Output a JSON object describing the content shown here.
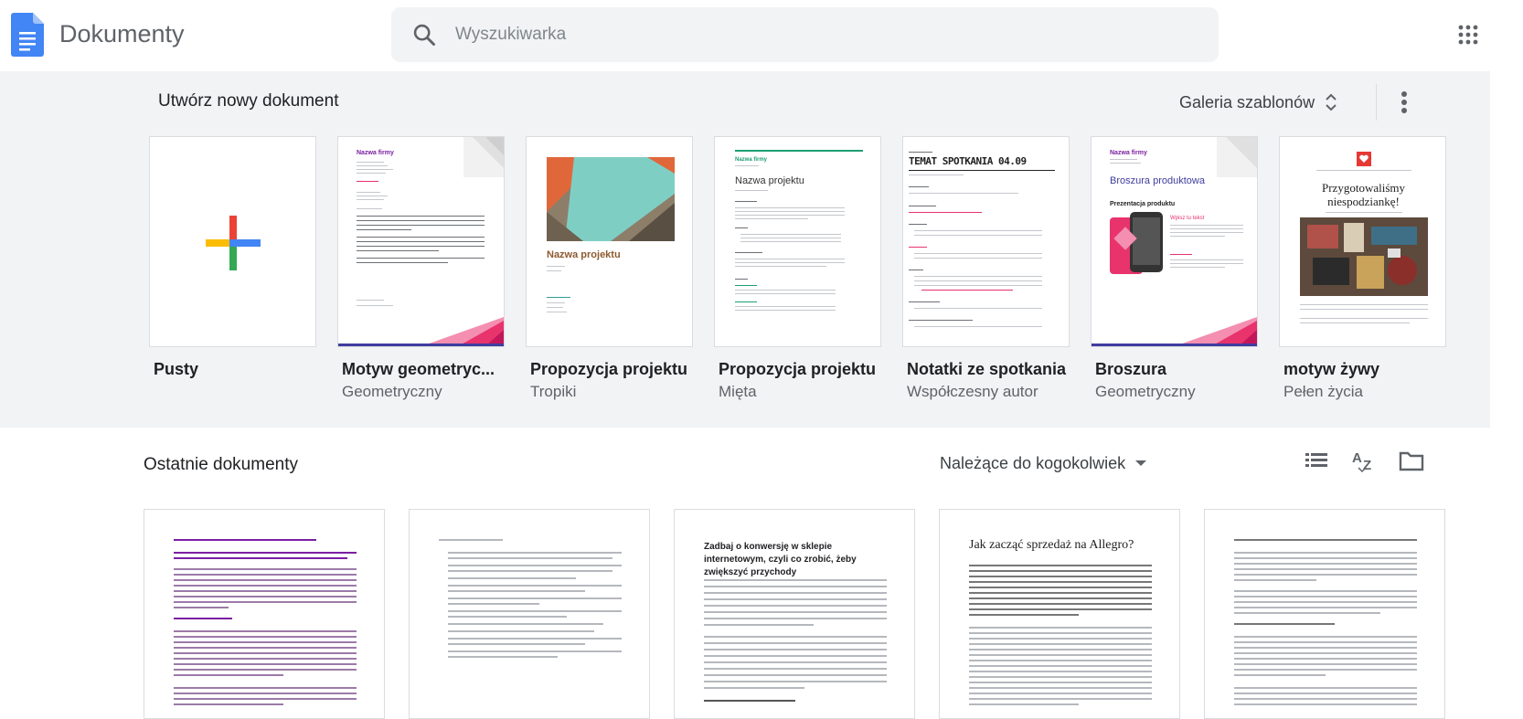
{
  "header": {
    "app_title": "Dokumenty",
    "search_placeholder": "Wyszukiwarka"
  },
  "gallery": {
    "title": "Utwórz nowy dokument",
    "gallery_button": "Galeria szablonów",
    "templates": [
      {
        "name": "Pusty",
        "subtitle": ""
      },
      {
        "name": "Motyw geometryczny",
        "subtitle": "Geometryczny",
        "thumb_title": "Nazwa firmy"
      },
      {
        "name": "Propozycja projektu",
        "subtitle": "Tropiki",
        "thumb_title": "Nazwa projektu"
      },
      {
        "name": "Propozycja projektu",
        "subtitle": "Mięta",
        "thumb_title": "Nazwa projektu"
      },
      {
        "name": "Notatki ze spotkania",
        "subtitle": "Współczesny autor",
        "thumb_title": "TEMAT SPOTKANIA 04.09"
      },
      {
        "name": "Broszura",
        "subtitle": "Geometryczny",
        "thumb_title": "Broszura produktowa",
        "thumb_subtitle": "Prezentacja produktu"
      },
      {
        "name": "motyw żywy",
        "subtitle": "Pełen życia",
        "thumb_title": "Przygotowaliśmy niespodziankę!"
      }
    ]
  },
  "recent": {
    "title": "Ostatnie dokumenty",
    "owner_filter": "Należące do kogokolwiek",
    "docs": [
      {
        "heading": ""
      },
      {
        "heading": ""
      },
      {
        "heading": "Zadbaj o konwersję w sklepie internetowym, czyli co zrobić, żeby zwiększyć przychody"
      },
      {
        "heading": "Jak zacząć sprzedaż na Allegro?"
      },
      {
        "heading": ""
      }
    ]
  },
  "colors": {
    "docs_blue": "#4285f4",
    "header_bg": "#ffffff",
    "gallery_bg": "#f1f3f4",
    "text_primary": "#202124",
    "text_secondary": "#5f6368",
    "accent_pink": "#e8336d",
    "accent_purple": "#7b1fa2"
  },
  "icons": [
    "docs-logo-icon",
    "search-icon",
    "apps-grid-icon",
    "unfold-icon",
    "more-vert-icon",
    "plus-icon",
    "dropdown-arrow-icon",
    "list-view-icon",
    "sort-az-icon",
    "folder-icon"
  ]
}
